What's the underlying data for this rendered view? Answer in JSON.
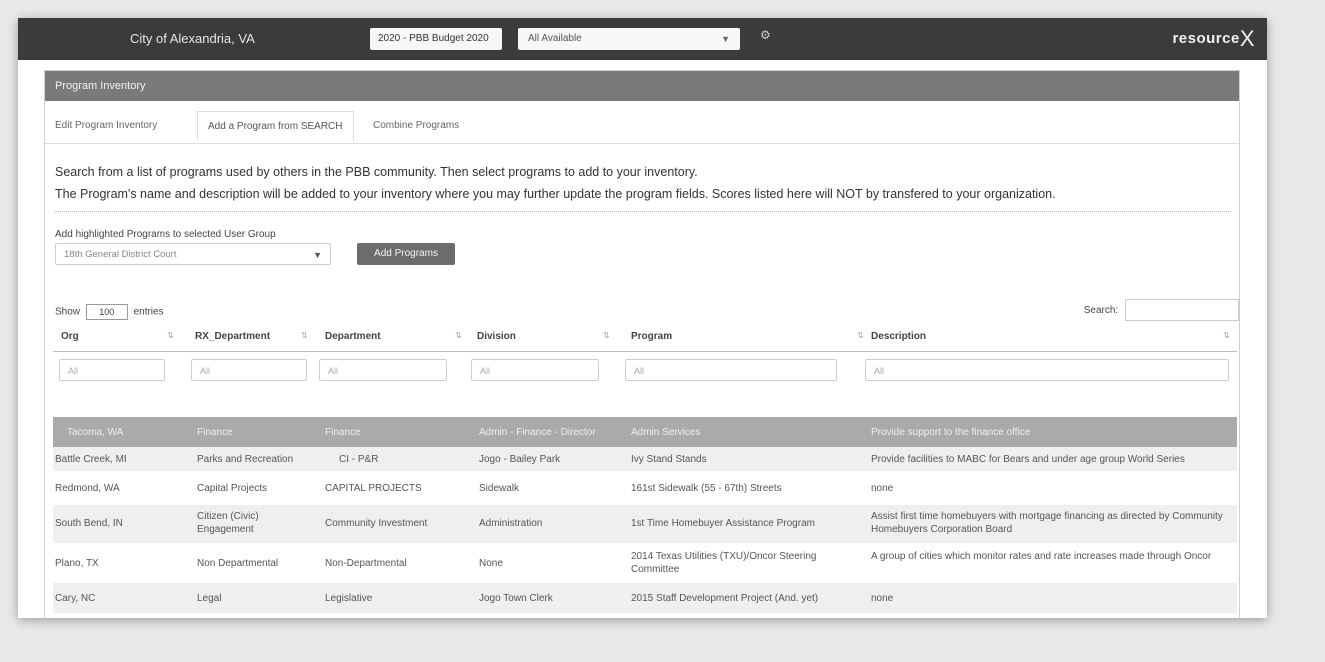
{
  "topbar": {
    "user_text": "",
    "org": "City of Alexandria, VA",
    "budget": "2020 - PBB Budget 2020",
    "availability": "All Available",
    "gear_text": "",
    "brand": "resource",
    "brand_x": "X"
  },
  "panel": {
    "title": "Program Inventory"
  },
  "tabs": [
    {
      "label": "Edit Program Inventory"
    },
    {
      "label": "Add a Program from SEARCH"
    },
    {
      "label": "Combine Programs"
    }
  ],
  "intro": {
    "line1": "Search from a list of programs used by others in the PBB community. Then select programs to add to your inventory.",
    "line2": "The Program's name and description will be added to your inventory where you may further update the program fields. Scores listed here will NOT by transfered to your organization."
  },
  "group": {
    "label": "Add highlighted Programs to selected User Group",
    "selected": "18th General District Court",
    "add_button": "Add Programs"
  },
  "table_controls": {
    "show_prefix": "Show",
    "show_value": "100",
    "show_suffix": "entries",
    "search_label": "Search:"
  },
  "columns": [
    "Org",
    "RX_Department",
    "Department",
    "Division",
    "Program",
    "Description"
  ],
  "filters": [
    "All",
    "All",
    "All",
    "All",
    "All",
    "All"
  ],
  "rows": [
    {
      "org": "Tacoma, WA",
      "rx": "Finance",
      "dept": "Finance",
      "div": "Admin - Finance - Director",
      "prog": "Admin Services",
      "desc": "Provide support to the finance office"
    },
    {
      "org": "Battle Creek, MI",
      "rx": "Parks and Recreation",
      "dept": "CI - P&R",
      "div": "Jogo - Bailey Park",
      "prog": "Ivy Stand Stands",
      "desc": "Provide facilities to MABC for Bears and under age group World Series"
    },
    {
      "org": "Redmond, WA",
      "rx": "Capital Projects",
      "dept": "CAPITAL PROJECTS",
      "div": "Sidewalk",
      "prog": "161st Sidewalk (55 - 67th) Streets",
      "desc": "none"
    },
    {
      "org": "South Bend, IN",
      "rx": "Citizen (Civic) Engagement",
      "dept": "Community Investment",
      "div": "Administration",
      "prog": "1st Time Homebuyer Assistance Program",
      "desc": "Assist first time homebuyers with mortgage financing as directed by Community Homebuyers Corporation Board"
    },
    {
      "org": "Plano, TX",
      "rx": "Non Departmental",
      "dept": "Non-Departmental",
      "div": "None",
      "prog": "2014 Texas Utilities (TXU)/Oncor Steering Committee",
      "desc": "A group of cities which monitor rates and rate increases made through Oncor"
    },
    {
      "org": "Cary, NC",
      "rx": "Legal",
      "dept": "Legislative",
      "div": "Jogo Town Clerk",
      "prog": "2015 Staff Development Project (And. yet)",
      "desc": "none"
    }
  ]
}
